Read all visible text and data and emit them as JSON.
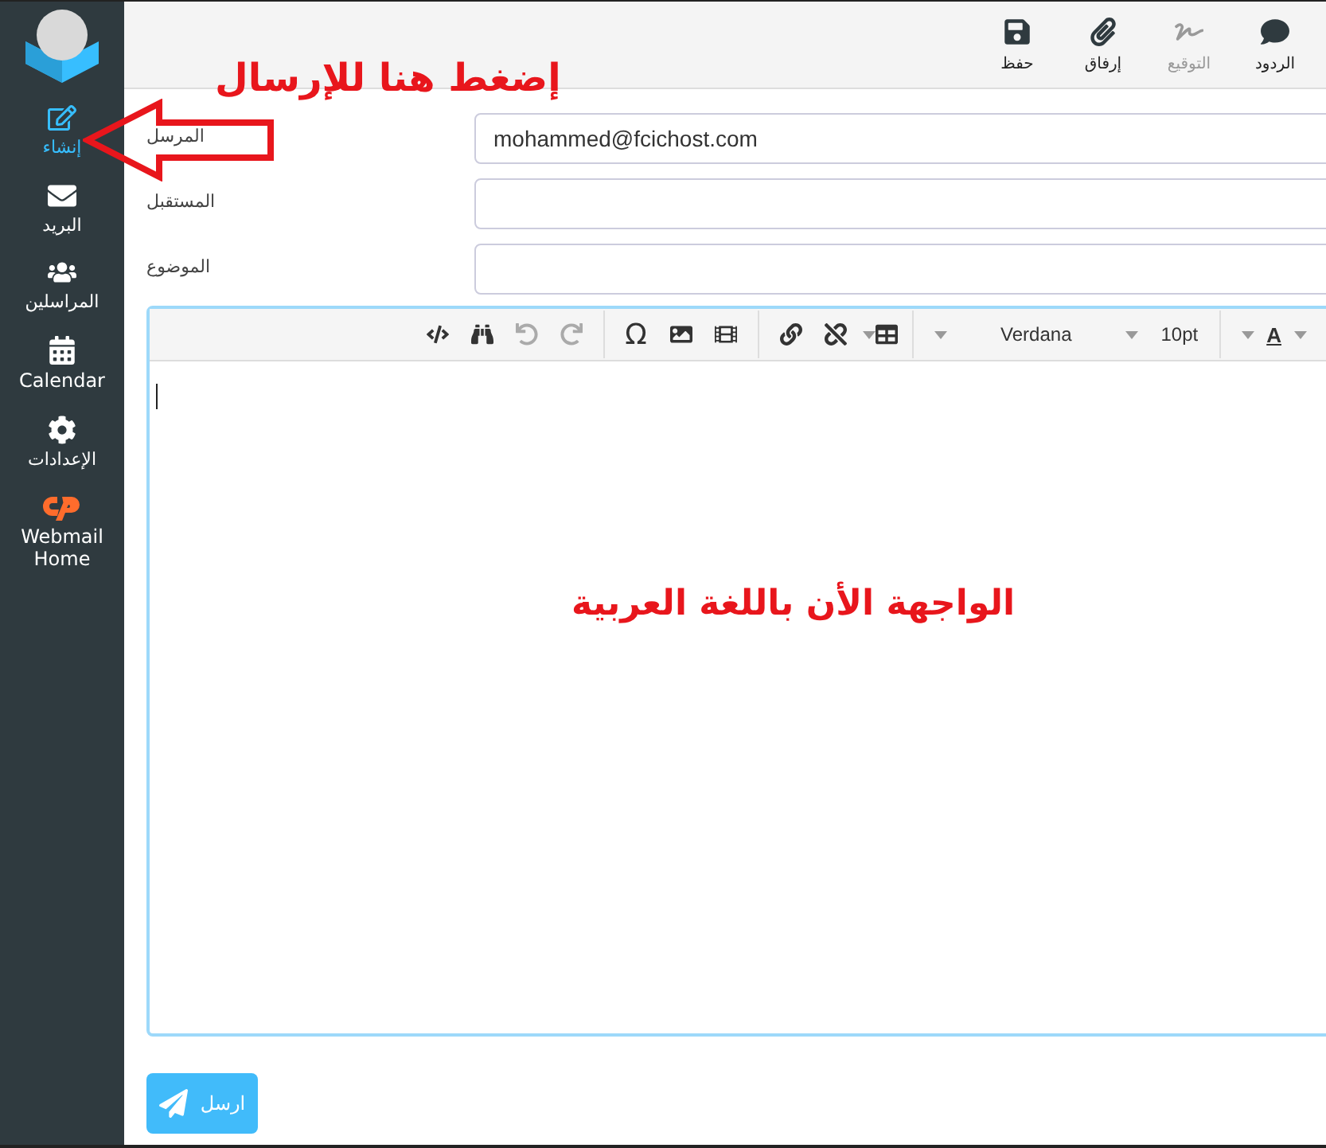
{
  "sidebar": {
    "items": [
      {
        "kind": "compose",
        "label": "إنشاء",
        "selected": true
      },
      {
        "kind": "mail",
        "label": "البريد",
        "selected": false
      },
      {
        "kind": "contacts",
        "label": "المراسلين",
        "selected": false
      },
      {
        "kind": "calendar",
        "label": "Calendar",
        "selected": false
      },
      {
        "kind": "settings",
        "label": "الإعدادات",
        "selected": false
      },
      {
        "kind": "cpanel",
        "label": "Webmail Home",
        "selected": false
      }
    ]
  },
  "toolbar": {
    "buttons": [
      {
        "kind": "responses",
        "label": "الردود",
        "disabled": false
      },
      {
        "kind": "signature",
        "label": "التوقيع",
        "disabled": true
      },
      {
        "kind": "attach",
        "label": "إرفاق",
        "disabled": false
      },
      {
        "kind": "save",
        "label": "حفظ",
        "disabled": false
      }
    ]
  },
  "form": {
    "fields": [
      {
        "label": "المرسل",
        "value": "mohammed@fcichost.com"
      },
      {
        "label": "المستقبل"
      },
      {
        "label": "الموضوع"
      }
    ]
  },
  "editor": {
    "toolbar": [
      {
        "kind": "color",
        "label": "A"
      },
      {
        "kind": "separator"
      },
      {
        "kind": "size",
        "label": "10pt"
      },
      {
        "kind": "font",
        "label": "Verdana"
      },
      {
        "kind": "separator"
      },
      {
        "kind": "table",
        "disabled": false
      },
      {
        "kind": "unlink",
        "disabled": false
      },
      {
        "kind": "link",
        "disabled": false
      },
      {
        "kind": "separator"
      },
      {
        "kind": "media",
        "disabled": false
      },
      {
        "kind": "image",
        "disabled": false
      },
      {
        "kind": "charmap",
        "label": "Ω",
        "disabled": false
      },
      {
        "kind": "separator"
      },
      {
        "kind": "redo",
        "disabled": true
      },
      {
        "kind": "undo",
        "disabled": true
      },
      {
        "kind": "find",
        "disabled": false
      },
      {
        "kind": "source",
        "disabled": false
      }
    ]
  },
  "annotations": {
    "callout": "إضغط هنا للإرسال",
    "note": "الواجهة الأن باللغة العربية"
  },
  "send_button": {
    "label": "ارسل"
  }
}
